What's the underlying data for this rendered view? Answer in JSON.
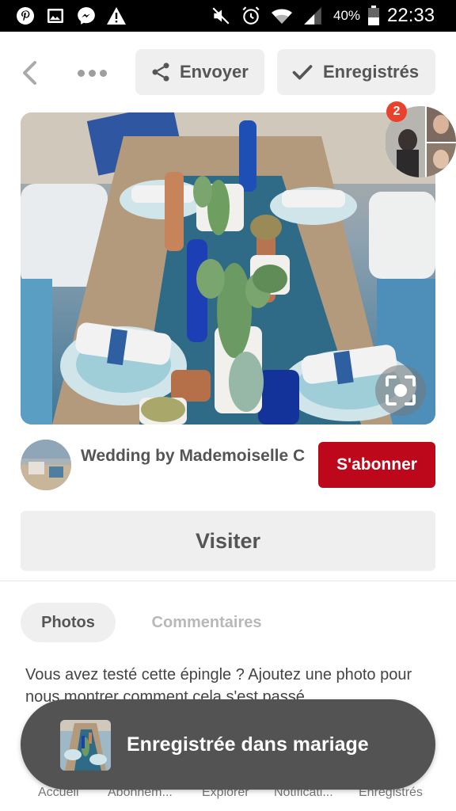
{
  "status_bar": {
    "battery_percent": "40%",
    "time": "22:33",
    "left_icons": [
      "pinterest-icon",
      "gallery-icon",
      "messenger-icon",
      "warning-icon"
    ],
    "right_icons": [
      "mute-icon",
      "alarm-icon",
      "wifi-icon",
      "signal-icon",
      "battery-icon"
    ]
  },
  "header": {
    "send_label": "Envoyer",
    "saved_label": "Enregistrés"
  },
  "pin": {
    "image_description_icon": "table-setting-photo",
    "notification_count": "2",
    "author_name": "Wedding by Mademoiselle C",
    "follow_label": "S'abonner",
    "visit_label": "Visiter"
  },
  "tabs": {
    "photos": "Photos",
    "comments": "Commentaires"
  },
  "prompt_text": "Vous avez testé cette épingle ? Ajoutez une photo pour nous montrer comment cela s'est passé",
  "toast": {
    "message": "Enregistrée dans mariage"
  },
  "bottom_nav": {
    "items": [
      "Accueil",
      "Abonnem...",
      "Explorer",
      "Notificati...",
      "Enregistrés"
    ]
  },
  "colors": {
    "accent_red": "#bd081c",
    "badge_red": "#e8412c",
    "button_gray": "#efefef",
    "toast_bg": "#535353"
  }
}
